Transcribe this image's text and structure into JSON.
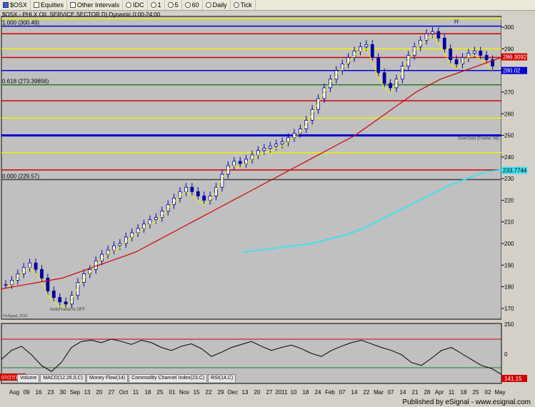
{
  "toolbar": {
    "symbol": "$OSX",
    "items": [
      "Equities",
      "Other Intervals",
      "IDC",
      "1",
      "5",
      "60",
      "Daily",
      "Tick"
    ]
  },
  "chart_title": "$OSX - PHLX OIL SERVICE SECTOR.D) Dynamic.0:00-24:00",
  "fib_labels": {
    "top": "1.000 (300.49)",
    "mid": "0.618 (273.39856)",
    "bottom": "0.000 (229.57)"
  },
  "annotations": {
    "oversold": "OverSold (Frame: 84)",
    "autoframe": "AutoFrame is OFF",
    "copyright": "©eSignal, 2010",
    "h_marker": "H"
  },
  "price_tags": {
    "last": "286.3092",
    "blue": "280.02",
    "cyan": "233.7744",
    "rsi": "141.15"
  },
  "tabs": [
    "Volume",
    "MACD(12,26,9,C)",
    "Money Flow(14)",
    "Commodity Channel Index(23,C)",
    "RSI(14,C)"
  ],
  "date_stamp": "07/27/10",
  "footer": "Published by eSignal - www.esignal.com",
  "colors": {
    "plot_bg": "#c0c0c0",
    "ma_red": "#d00000",
    "ma_cyan": "#40e0f0",
    "line_yellow": "#f0f000",
    "line_blue": "#0000d0",
    "bars": "#0000a0"
  },
  "chart_data": {
    "type": "candlestick",
    "y_axis": {
      "min": 165,
      "max": 305,
      "ticks": [
        170,
        180,
        190,
        200,
        210,
        220,
        230,
        240,
        250,
        260,
        270,
        280,
        290,
        300
      ]
    },
    "x_axis_labels": [
      "Aug",
      "09",
      "16",
      "23",
      "30",
      "Sep",
      "13",
      "20",
      "27",
      "Oct",
      "11",
      "18",
      "25",
      "01",
      "Nov",
      "15",
      "22",
      "29",
      "Dec",
      "13",
      "20",
      "27",
      "2011",
      "10",
      "18",
      "24",
      "Feb",
      "07",
      "14",
      "22",
      "Mar",
      "07",
      "14",
      "21",
      "28",
      "Apr",
      "11",
      "18",
      "25",
      "02",
      "May"
    ],
    "close_path": [
      181,
      183,
      186,
      189,
      191,
      188,
      184,
      178,
      175,
      173,
      172,
      176,
      182,
      186,
      188,
      192,
      195,
      197,
      199,
      200,
      203,
      205,
      207,
      209,
      211,
      212,
      215,
      218,
      221,
      224,
      226,
      224,
      222,
      220,
      222,
      226,
      232,
      236,
      238,
      237,
      239,
      241,
      243,
      244,
      245,
      246,
      247,
      249,
      251,
      253,
      257,
      262,
      267,
      272,
      276,
      280,
      283,
      286,
      289,
      291,
      292,
      286,
      279,
      274,
      272,
      276,
      282,
      287,
      291,
      294,
      297,
      298,
      295,
      290,
      285,
      283,
      286,
      288,
      289,
      287,
      285,
      282
    ],
    "moving_average_red": [
      179,
      180,
      181,
      182,
      183,
      184,
      186,
      188,
      190,
      192,
      194,
      196,
      199,
      202,
      205,
      208,
      211,
      214,
      217,
      220,
      223,
      226,
      229,
      232,
      235,
      238,
      241,
      244,
      247,
      250,
      254,
      258,
      262,
      266,
      270,
      273,
      276,
      278,
      280,
      282,
      284,
      286
    ],
    "moving_average_cyan": [
      196,
      197,
      198,
      199,
      200,
      202,
      204,
      207,
      211,
      215,
      219,
      223,
      227,
      230,
      233,
      234
    ],
    "horizontal_lines": [
      {
        "value": 304,
        "color": "yellow"
      },
      {
        "value": 300.49,
        "color": "blue"
      },
      {
        "value": 297,
        "color": "red"
      },
      {
        "value": 290,
        "color": "yellow"
      },
      {
        "value": 286,
        "color": "red"
      },
      {
        "value": 280,
        "color": "blue"
      },
      {
        "value": 273.4,
        "color": "green"
      },
      {
        "value": 266,
        "color": "red"
      },
      {
        "value": 258,
        "color": "yellow"
      },
      {
        "value": 250,
        "color": "blue"
      },
      {
        "value": 242,
        "color": "yellow"
      },
      {
        "value": 234,
        "color": "red"
      },
      {
        "value": 229.57,
        "color": "black"
      }
    ],
    "rsi_panel": {
      "ticks": [
        250,
        0
      ],
      "label": "RSI(14,C)"
    }
  }
}
